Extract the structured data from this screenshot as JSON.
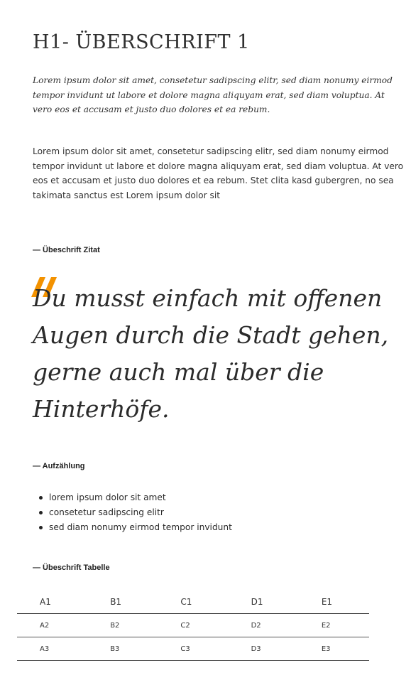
{
  "heading": {
    "title": "H1- ÜBERSCHRIFT 1"
  },
  "lead": {
    "text": "Lorem ipsum dolor sit amet, consetetur sadipscing elitr, sed diam nonumy eirmod tempor invidunt ut labore et dolore magna aliquyam erat, sed diam voluptua. At vero eos et accusam et justo duo dolores et ea rebum."
  },
  "body": {
    "text": "Lorem ipsum dolor sit amet, consetetur sadipscing elitr, sed diam nonumy eirmod tempor invidunt ut labore et dolore magna aliquyam erat, sed diam voluptua. At vero eos et accusam et justo duo dolores et ea rebum. Stet clita kasd gubergren, no sea takimata sanctus est Lorem ipsum dolor sit"
  },
  "quote_section": {
    "label": "— Übeschrift Zitat",
    "quote": "Du musst einfach mit offenen Augen durch die Stadt gehen, gerne auch mal über die Hinterhöfe.",
    "mark_icon": "quotation-mark-icon",
    "accent_color": "#f39200"
  },
  "list_section": {
    "label": "— Aufzählung",
    "items": [
      "lorem ipsum dolor sit amet",
      "consetetur sadipscing elitr",
      "sed diam nonumy eirmod tempor invidunt"
    ]
  },
  "table_section": {
    "label": "— Übeschrift Tabelle",
    "headers": [
      "A1",
      "B1",
      "C1",
      "D1",
      "E1"
    ],
    "rows": [
      [
        "A2",
        "B2",
        "C2",
        "D2",
        "E2"
      ],
      [
        "A3",
        "B3",
        "C3",
        "D3",
        "E3"
      ]
    ]
  }
}
